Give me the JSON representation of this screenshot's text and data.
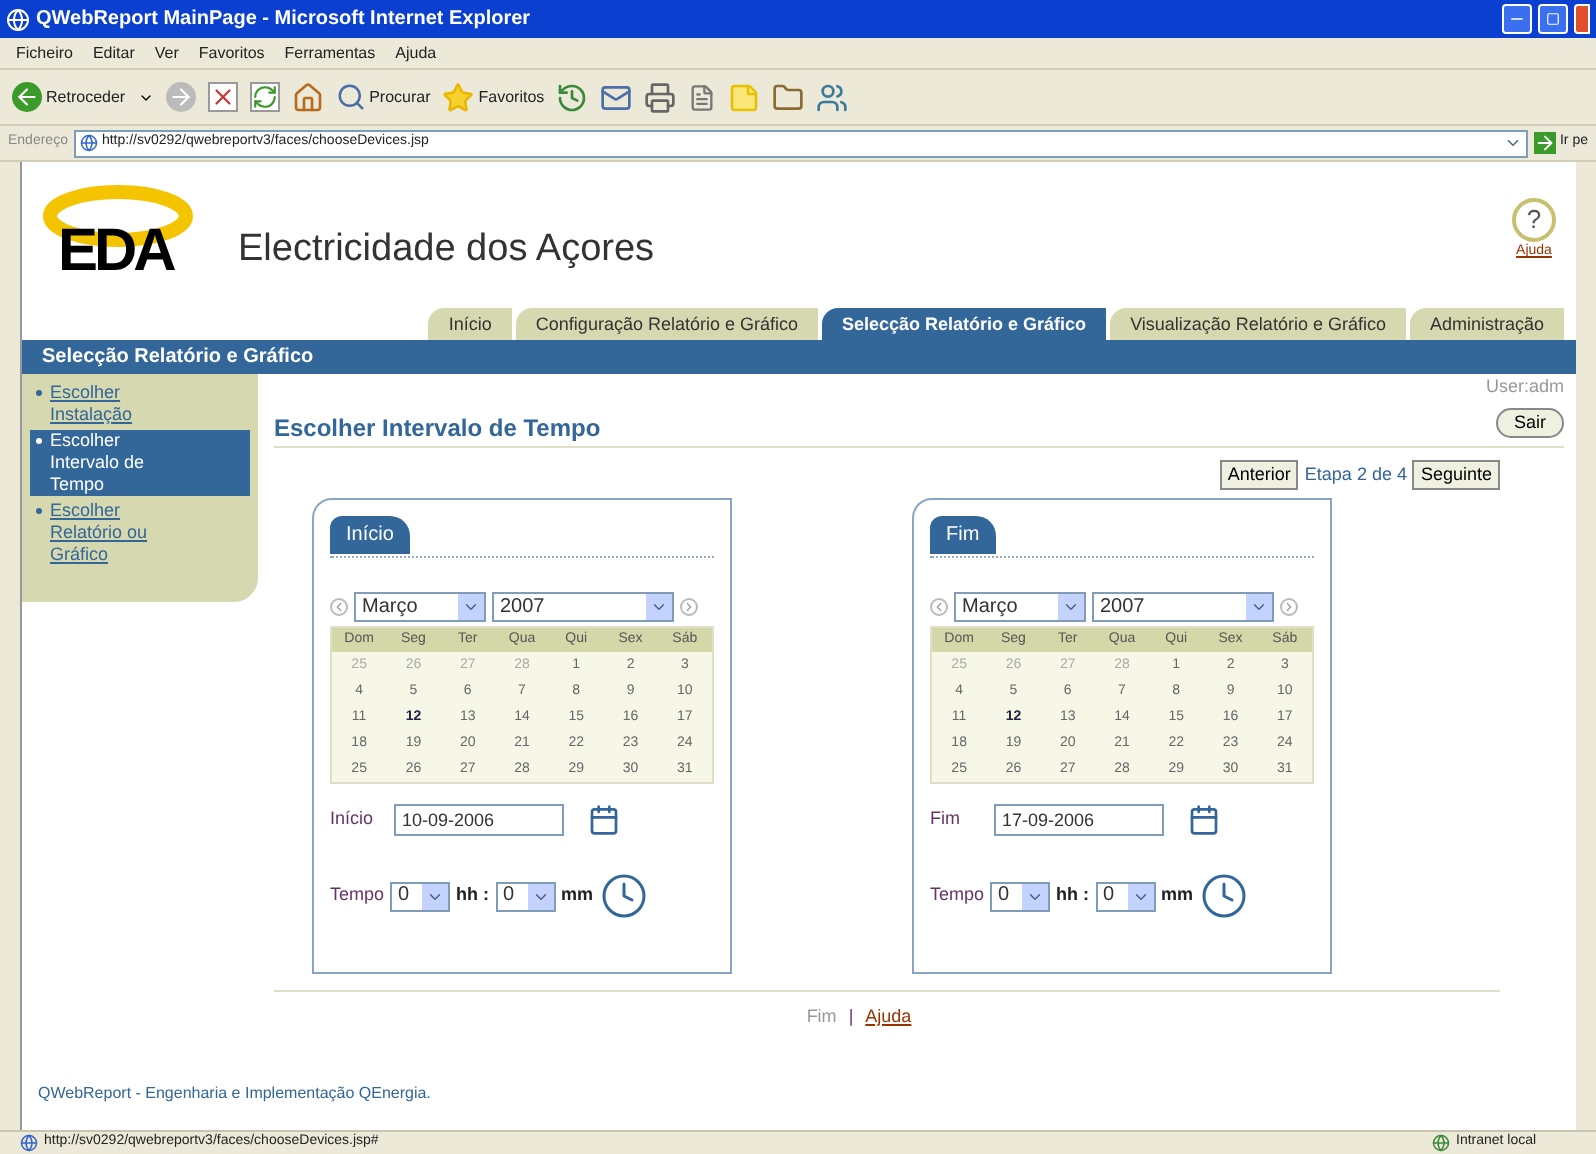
{
  "window": {
    "title": "QWebReport MainPage - Microsoft Internet Explorer"
  },
  "menu": [
    "Ficheiro",
    "Editar",
    "Ver",
    "Favoritos",
    "Ferramentas",
    "Ajuda"
  ],
  "toolbar": {
    "back": "Retroceder",
    "search": "Procurar",
    "favorites": "Favoritos"
  },
  "address": {
    "label": "Endereço",
    "url": "http://sv0292/qwebreportv3/faces/chooseDevices.jsp",
    "go": "Ir pe"
  },
  "brand": {
    "logo": "EDA",
    "name": "Electricidade dos Açores",
    "help_mark": "?",
    "help": "Ajuda"
  },
  "tabs": [
    {
      "label": "Início",
      "selected": false
    },
    {
      "label": "Configuração Relatório e Gráfico",
      "selected": false
    },
    {
      "label": "Selecção Relatório e Gráfico",
      "selected": true
    },
    {
      "label": "Visualização Relatório e Gráfico",
      "selected": false
    },
    {
      "label": "Administração",
      "selected": false
    }
  ],
  "section_bar": "Selecção Relatório e Gráfico",
  "sidebar": {
    "items": [
      {
        "label": "Escolher Instalação",
        "selected": false
      },
      {
        "label": "Escolher Intervalo de Tempo",
        "selected": true
      },
      {
        "label": "Escolher Relatório ou Gráfico",
        "selected": false
      }
    ]
  },
  "user": "User:adm",
  "logout": "Sair",
  "heading": "Escolher Intervalo de Tempo",
  "wizard": {
    "back": "Anterior",
    "step": "Etapa 2 de 4",
    "next": "Seguinte"
  },
  "panels": [
    {
      "tab": "Início",
      "weekdays": [
        "Dom",
        "Seg",
        "Ter",
        "Qua",
        "Qui",
        "Sex",
        "Sáb"
      ],
      "month": "Março",
      "year": "2007",
      "date_label": "Início",
      "date": "10-09-2006",
      "time_label": "Tempo",
      "hours": "0",
      "hh": "hh :",
      "minutes": "0",
      "mm": "mm",
      "days": [
        {
          "day": "25",
          "outside": true,
          "today": false
        },
        {
          "day": "26",
          "outside": true,
          "today": false
        },
        {
          "day": "27",
          "outside": true,
          "today": false
        },
        {
          "day": "28",
          "outside": true,
          "today": false
        },
        {
          "day": "1",
          "outside": false,
          "today": false
        },
        {
          "day": "2",
          "outside": false,
          "today": false
        },
        {
          "day": "3",
          "outside": false,
          "today": false
        },
        {
          "day": "4",
          "outside": false,
          "today": false
        },
        {
          "day": "5",
          "outside": false,
          "today": false
        },
        {
          "day": "6",
          "outside": false,
          "today": false
        },
        {
          "day": "7",
          "outside": false,
          "today": false
        },
        {
          "day": "8",
          "outside": false,
          "today": false
        },
        {
          "day": "9",
          "outside": false,
          "today": false
        },
        {
          "day": "10",
          "outside": false,
          "today": false
        },
        {
          "day": "11",
          "outside": false,
          "today": false
        },
        {
          "day": "12",
          "outside": false,
          "today": true
        },
        {
          "day": "13",
          "outside": false,
          "today": false
        },
        {
          "day": "14",
          "outside": false,
          "today": false
        },
        {
          "day": "15",
          "outside": false,
          "today": false
        },
        {
          "day": "16",
          "outside": false,
          "today": false
        },
        {
          "day": "17",
          "outside": false,
          "today": false
        },
        {
          "day": "18",
          "outside": false,
          "today": false
        },
        {
          "day": "19",
          "outside": false,
          "today": false
        },
        {
          "day": "20",
          "outside": false,
          "today": false
        },
        {
          "day": "21",
          "outside": false,
          "today": false
        },
        {
          "day": "22",
          "outside": false,
          "today": false
        },
        {
          "day": "23",
          "outside": false,
          "today": false
        },
        {
          "day": "24",
          "outside": false,
          "today": false
        },
        {
          "day": "25",
          "outside": false,
          "today": false
        },
        {
          "day": "26",
          "outside": false,
          "today": false
        },
        {
          "day": "27",
          "outside": false,
          "today": false
        },
        {
          "day": "28",
          "outside": false,
          "today": false
        },
        {
          "day": "29",
          "outside": false,
          "today": false
        },
        {
          "day": "30",
          "outside": false,
          "today": false
        },
        {
          "day": "31",
          "outside": false,
          "today": false
        }
      ]
    },
    {
      "tab": "Fim",
      "weekdays": [
        "Dom",
        "Seg",
        "Ter",
        "Qua",
        "Qui",
        "Sex",
        "Sáb"
      ],
      "month": "Março",
      "year": "2007",
      "date_label": "Fim",
      "date": "17-09-2006",
      "time_label": "Tempo",
      "hours": "0",
      "hh": "hh :",
      "minutes": "0",
      "mm": "mm",
      "days": [
        {
          "day": "25",
          "outside": true,
          "today": false
        },
        {
          "day": "26",
          "outside": true,
          "today": false
        },
        {
          "day": "27",
          "outside": true,
          "today": false
        },
        {
          "day": "28",
          "outside": true,
          "today": false
        },
        {
          "day": "1",
          "outside": false,
          "today": false
        },
        {
          "day": "2",
          "outside": false,
          "today": false
        },
        {
          "day": "3",
          "outside": false,
          "today": false
        },
        {
          "day": "4",
          "outside": false,
          "today": false
        },
        {
          "day": "5",
          "outside": false,
          "today": false
        },
        {
          "day": "6",
          "outside": false,
          "today": false
        },
        {
          "day": "7",
          "outside": false,
          "today": false
        },
        {
          "day": "8",
          "outside": false,
          "today": false
        },
        {
          "day": "9",
          "outside": false,
          "today": false
        },
        {
          "day": "10",
          "outside": false,
          "today": false
        },
        {
          "day": "11",
          "outside": false,
          "today": false
        },
        {
          "day": "12",
          "outside": false,
          "today": true
        },
        {
          "day": "13",
          "outside": false,
          "today": false
        },
        {
          "day": "14",
          "outside": false,
          "today": false
        },
        {
          "day": "15",
          "outside": false,
          "today": false
        },
        {
          "day": "16",
          "outside": false,
          "today": false
        },
        {
          "day": "17",
          "outside": false,
          "today": false
        },
        {
          "day": "18",
          "outside": false,
          "today": false
        },
        {
          "day": "19",
          "outside": false,
          "today": false
        },
        {
          "day": "20",
          "outside": false,
          "today": false
        },
        {
          "day": "21",
          "outside": false,
          "today": false
        },
        {
          "day": "22",
          "outside": false,
          "today": false
        },
        {
          "day": "23",
          "outside": false,
          "today": false
        },
        {
          "day": "24",
          "outside": false,
          "today": false
        },
        {
          "day": "25",
          "outside": false,
          "today": false
        },
        {
          "day": "26",
          "outside": false,
          "today": false
        },
        {
          "day": "27",
          "outside": false,
          "today": false
        },
        {
          "day": "28",
          "outside": false,
          "today": false
        },
        {
          "day": "29",
          "outside": false,
          "today": false
        },
        {
          "day": "30",
          "outside": false,
          "today": false
        },
        {
          "day": "31",
          "outside": false,
          "today": false
        }
      ]
    }
  ],
  "footer_links": [
    "Fim",
    "Ajuda"
  ],
  "footer_sep": "|",
  "copyright": "QWebReport - Engenharia e Implementação QEnergia.",
  "status_bar": {
    "url": "http://sv0292/qwebreportv3/faces/chooseDevices.jsp#",
    "zone": "Intranet local"
  }
}
